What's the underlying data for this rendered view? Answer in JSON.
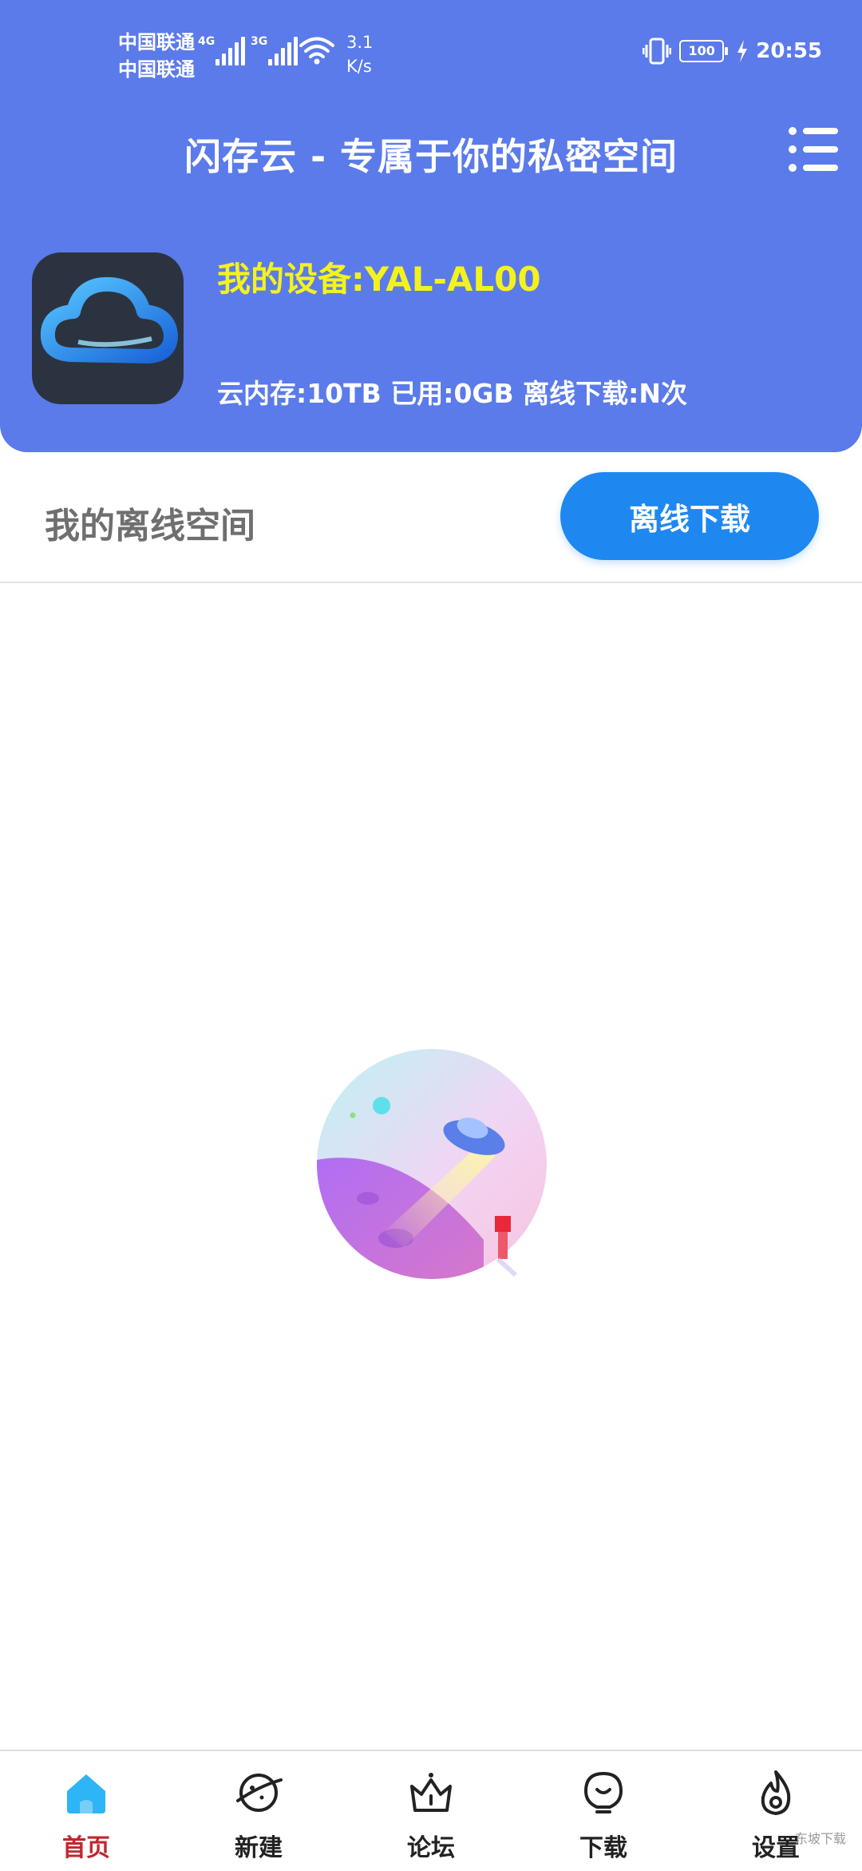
{
  "status_bar": {
    "carrier_1": "中国联通",
    "carrier_2": "中国联通",
    "signal_1_type": "4G",
    "signal_2_type": "3G",
    "speed_value": "3.1",
    "speed_unit": "K/s",
    "battery": "100",
    "time": "20:55"
  },
  "header": {
    "title": "闪存云 - 专属于你的私密空间",
    "device": "我的设备:YAL-AL00",
    "stats": "云内存:10TB 已用:0GB 离线下载:N次",
    "accent_color": "#5b7bea",
    "device_color": "#f4f21c"
  },
  "section": {
    "label": "我的离线空间",
    "download_button": "离线下载",
    "button_color": "#1e88f0"
  },
  "tabs": [
    {
      "label": "首页",
      "icon": "home-icon"
    },
    {
      "label": "新建",
      "icon": "planet-icon"
    },
    {
      "label": "论坛",
      "icon": "crown-icon"
    },
    {
      "label": "下载",
      "icon": "bulb-icon"
    },
    {
      "label": "设置",
      "icon": "flame-icon"
    }
  ],
  "watermark": "东坡下载"
}
